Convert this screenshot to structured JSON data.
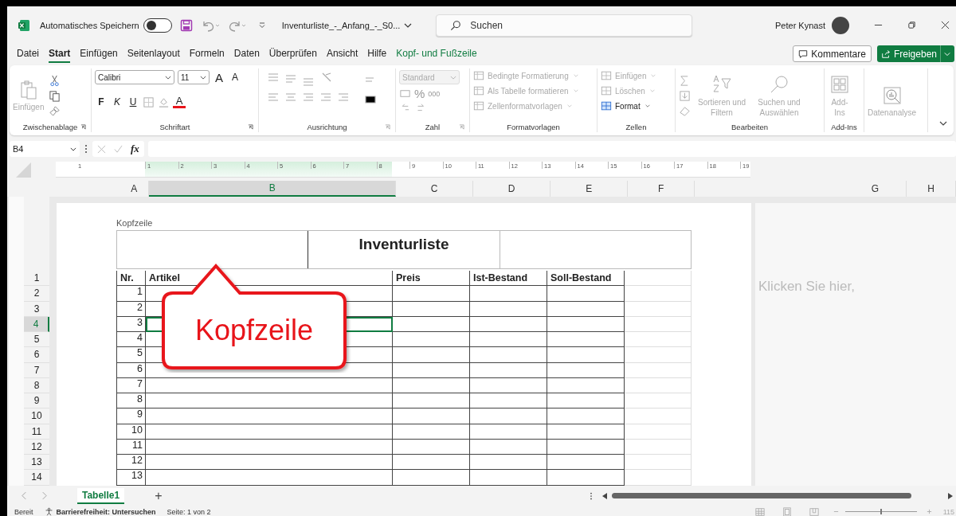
{
  "title_bar": {
    "autosave_label": "Automatisches Speichern",
    "autosave_on": false,
    "file_name": "Inventurliste_-_Anfang_-_S0...",
    "search_placeholder": "Suchen",
    "user_name": "Peter Kynast"
  },
  "ribbon_tabs": [
    {
      "label": "Datei",
      "selected": false,
      "kind": "normal"
    },
    {
      "label": "Start",
      "selected": true,
      "kind": "normal"
    },
    {
      "label": "Einfügen",
      "selected": false,
      "kind": "normal"
    },
    {
      "label": "Seitenlayout",
      "selected": false,
      "kind": "normal"
    },
    {
      "label": "Formeln",
      "selected": false,
      "kind": "normal"
    },
    {
      "label": "Daten",
      "selected": false,
      "kind": "normal"
    },
    {
      "label": "Überprüfen",
      "selected": false,
      "kind": "normal"
    },
    {
      "label": "Ansicht",
      "selected": false,
      "kind": "normal"
    },
    {
      "label": "Hilfe",
      "selected": false,
      "kind": "normal"
    },
    {
      "label": "Kopf- und Fußzeile",
      "selected": false,
      "kind": "contextual"
    }
  ],
  "comments_button": "Kommentare",
  "share_button": "Freigeben",
  "ribbon": {
    "clipboard": {
      "paste_label": "Einfügen",
      "paste_disabled": true,
      "group": "Zwischenablage"
    },
    "font": {
      "name": "Calibri",
      "size": "11",
      "grow": "A",
      "shrink": "A",
      "bold": "F",
      "italic": "K",
      "underline": "U",
      "color_letter": "A",
      "group": "Schriftart"
    },
    "alignment": {
      "group": "Ausrichtung"
    },
    "number": {
      "format": "Standard",
      "percent": "%",
      "thousands": "000",
      "group": "Zahl"
    },
    "styles": {
      "items": [
        {
          "label": "Bedingte Formatierung",
          "disabled": true
        },
        {
          "label": "Als Tabelle formatieren",
          "disabled": true
        },
        {
          "label": "Zellenformatvorlagen",
          "disabled": true
        }
      ],
      "group": "Formatvorlagen"
    },
    "cells": {
      "items": [
        {
          "label": "Einfügen",
          "disabled": true
        },
        {
          "label": "Löschen",
          "disabled": true
        },
        {
          "label": "Format",
          "disabled": false
        }
      ],
      "group": "Zellen"
    },
    "editing": {
      "sort_label": "Sortieren und Filtern",
      "find_label": "Suchen und Auswählen",
      "group": "Bearbeiten"
    },
    "addins": {
      "label": "Add-Ins",
      "group": "Add-Ins"
    },
    "analysis": {
      "label": "Datenanalyse"
    }
  },
  "formula_bar": {
    "name_box": "B4",
    "fx": "fx"
  },
  "ruler": [
    "1",
    "1",
    "2",
    "3",
    "4",
    "5",
    "6",
    "7",
    "8",
    "9",
    "10",
    "11",
    "12",
    "13",
    "14",
    "15",
    "16",
    "17",
    "18",
    "19"
  ],
  "columns": [
    {
      "label": "A",
      "selected": false
    },
    {
      "label": "B",
      "selected": true
    },
    {
      "label": "C",
      "selected": false
    },
    {
      "label": "D",
      "selected": false
    },
    {
      "label": "E",
      "selected": false
    },
    {
      "label": "F",
      "selected": false
    }
  ],
  "right_columns": [
    {
      "label": "G",
      "selected": false
    },
    {
      "label": "H",
      "selected": false
    }
  ],
  "row_headers": [
    {
      "label": "1",
      "selected": false
    },
    {
      "label": "2",
      "selected": false
    },
    {
      "label": "3",
      "selected": false
    },
    {
      "label": "4",
      "selected": true
    },
    {
      "label": "5",
      "selected": false
    },
    {
      "label": "6",
      "selected": false
    },
    {
      "label": "7",
      "selected": false
    },
    {
      "label": "8",
      "selected": false
    },
    {
      "label": "9",
      "selected": false
    },
    {
      "label": "10",
      "selected": false
    },
    {
      "label": "11",
      "selected": false
    },
    {
      "label": "12",
      "selected": false
    },
    {
      "label": "13",
      "selected": false
    },
    {
      "label": "14",
      "selected": false
    }
  ],
  "header": {
    "caption": "Kopfzeile",
    "center": "Inventurliste"
  },
  "table": {
    "columns": [
      "Nr.",
      "Artikel",
      "Preis",
      "Ist-Bestand",
      "Soll-Bestand"
    ],
    "rows": [
      {
        "nr": "1",
        "selected": false
      },
      {
        "nr": "2",
        "selected": false
      },
      {
        "nr": "3",
        "selected": true
      },
      {
        "nr": "4",
        "selected": false
      },
      {
        "nr": "5",
        "selected": false
      },
      {
        "nr": "6",
        "selected": false
      },
      {
        "nr": "7",
        "selected": false
      },
      {
        "nr": "8",
        "selected": false
      },
      {
        "nr": "9",
        "selected": false
      },
      {
        "nr": "10",
        "selected": false
      },
      {
        "nr": "11",
        "selected": false
      },
      {
        "nr": "12",
        "selected": false
      },
      {
        "nr": "13",
        "selected": false
      }
    ]
  },
  "next_page_hint": "Klicken Sie hier,",
  "callout": {
    "text": "Kopfzeile"
  },
  "sheet_tabs": [
    {
      "label": "Tabelle1",
      "selected": true
    }
  ],
  "add_sheet": "+",
  "status_bar": {
    "ready": "Bereit",
    "accessibility": "Barrierefreiheit: Untersuchen",
    "page": "Seite: 1 von 2",
    "zoom_slider": {
      "level": 0.5
    },
    "zoom": "115"
  }
}
